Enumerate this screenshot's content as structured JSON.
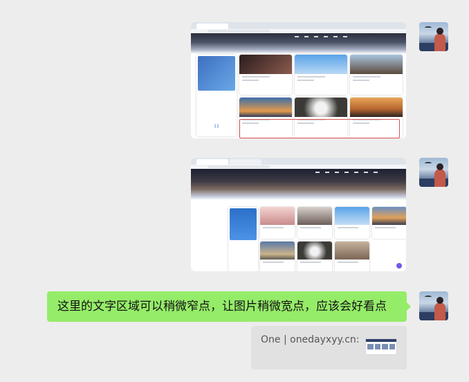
{
  "messages": {
    "text_message": "这里的文字区域可以稍微窄点，让图片稍微宽点，应该会好看点",
    "quote_text": "One | onedayxyy.cn:"
  },
  "screenshot1": {
    "date_number": "11"
  },
  "colors": {
    "bubble_green": "#95ec69",
    "chat_background": "#ededed",
    "highlight_red": "#d9534f"
  }
}
